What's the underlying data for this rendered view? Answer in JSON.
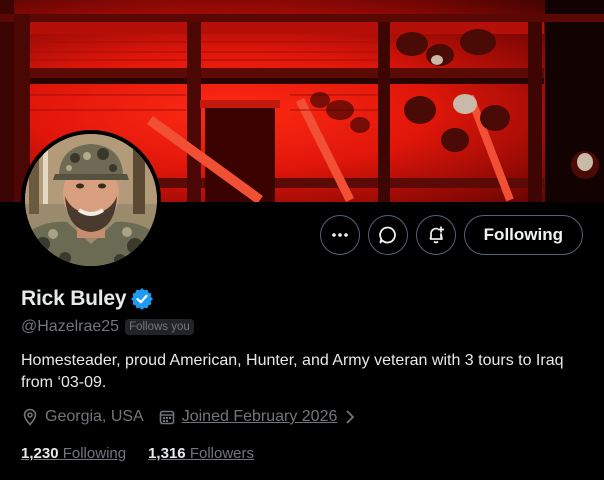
{
  "profile": {
    "display_name": "Rick Buley",
    "handle": "@Hazelrae25",
    "follows_you_badge": "Follows you",
    "bio": "Homesteader, proud American, Hunter, and Army veteran with 3 tours to Iraq from ‘03-09.",
    "location": "Georgia, USA",
    "joined": "Joined February 2026",
    "verified": true
  },
  "actions": {
    "more_icon": "more-horizontal-icon",
    "message_icon": "message-bubble-icon",
    "notify_icon": "bell-plus-icon",
    "follow_label": "Following"
  },
  "stats": {
    "following_count": "1,230",
    "following_label": "Following",
    "followers_count": "1,316",
    "followers_label": "Followers"
  },
  "colors": {
    "verified_badge": "#1d9bf0",
    "banner_red": "#e0160a",
    "text_secondary": "#71767b"
  }
}
